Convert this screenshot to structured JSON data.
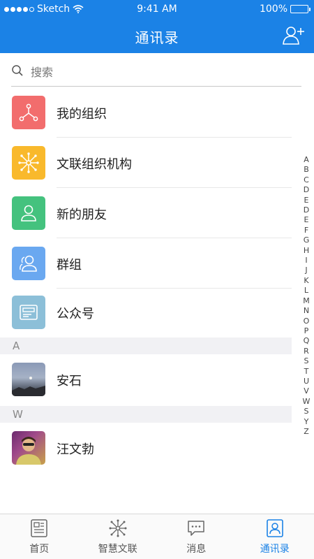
{
  "status_bar": {
    "carrier": "Sketch",
    "time": "9:41 AM",
    "battery": "100%"
  },
  "header": {
    "title": "通讯录"
  },
  "search": {
    "placeholder": "搜索"
  },
  "groups": [
    {
      "label": "我的组织",
      "icon": "org-tree-icon",
      "color": "#f26d6d"
    },
    {
      "label": "文联组织机构",
      "icon": "hub-icon",
      "color": "#f9b92c"
    },
    {
      "label": "新的朋友",
      "icon": "person-icon",
      "color": "#44c27e"
    },
    {
      "label": "群组",
      "icon": "group-icon",
      "color": "#6aa8f0"
    },
    {
      "label": "公众号",
      "icon": "public-account-icon",
      "color": "#8cbfd8"
    }
  ],
  "sections": [
    {
      "letter": "A",
      "contacts": [
        {
          "name": "安石"
        }
      ]
    },
    {
      "letter": "W",
      "contacts": [
        {
          "name": "汪文勃"
        }
      ]
    }
  ],
  "index_letters": [
    "A",
    "B",
    "C",
    "D",
    "E",
    "D",
    "E",
    "F",
    "G",
    "H",
    "I",
    "J",
    "K",
    "L",
    "M",
    "N",
    "O",
    "P",
    "Q",
    "R",
    "S",
    "T",
    "U",
    "V",
    "W",
    "S",
    "Y",
    "Z"
  ],
  "tabs": [
    {
      "label": "首页",
      "icon": "home-news-icon",
      "active": false
    },
    {
      "label": "智慧文联",
      "icon": "hub-icon",
      "active": false
    },
    {
      "label": "消息",
      "icon": "chat-bubble-icon",
      "active": false
    },
    {
      "label": "通讯录",
      "icon": "contacts-icon",
      "active": true
    }
  ],
  "colors": {
    "primary": "#1b82e6",
    "section_bg": "#f1f1f4"
  }
}
